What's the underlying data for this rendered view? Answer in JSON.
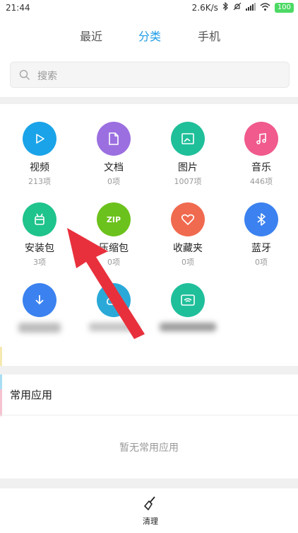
{
  "status_bar": {
    "time": "21:44",
    "speed": "2.6K/s",
    "battery": "100"
  },
  "tabs": [
    {
      "label": "最近",
      "active": false
    },
    {
      "label": "分类",
      "active": true
    },
    {
      "label": "手机",
      "active": false
    }
  ],
  "search": {
    "placeholder": "搜索"
  },
  "categories": [
    {
      "name": "视频",
      "count": "213项",
      "color": "#1aa3e8",
      "icon": "play-icon"
    },
    {
      "name": "文档",
      "count": "0项",
      "color": "#9b6fe0",
      "icon": "document-icon"
    },
    {
      "name": "图片",
      "count": "1007项",
      "color": "#1fbf9a",
      "icon": "image-icon"
    },
    {
      "name": "音乐",
      "count": "446项",
      "color": "#f05a8c",
      "icon": "music-icon"
    },
    {
      "name": "安装包",
      "count": "3项",
      "color": "#1fc38c",
      "icon": "android-icon"
    },
    {
      "name": "压缩包",
      "count": "0项",
      "color": "#6cc21c",
      "icon": "zip-icon"
    },
    {
      "name": "收藏夹",
      "count": "0项",
      "color": "#f06a4f",
      "icon": "heart-icon"
    },
    {
      "name": "蓝牙",
      "count": "0项",
      "color": "#3b82f0",
      "icon": "bluetooth-icon"
    },
    {
      "color": "#3b82f0",
      "icon": "download-icon"
    },
    {
      "color": "#2aa9d8",
      "icon": "cloud-icon"
    },
    {
      "color": "#1fbf9a",
      "icon": "wifi-transfer-icon"
    }
  ],
  "zip_label": "ZIP",
  "frequent_apps": {
    "title": "常用应用",
    "empty_text": "暂无常用应用"
  },
  "bottom": {
    "clean_label": "清理"
  }
}
